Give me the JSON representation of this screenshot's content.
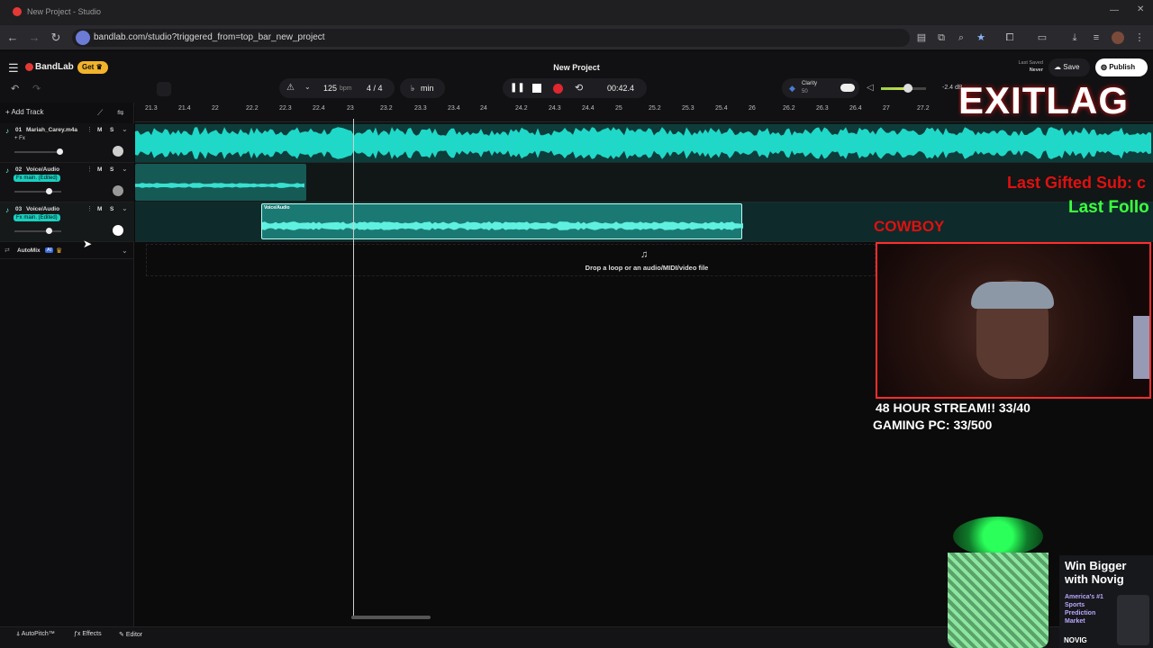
{
  "browser": {
    "tab_title": "New Project - Studio",
    "url": "bandlab.com/studio?triggered_from=top_bar_new_project"
  },
  "app": {
    "brand": "BandLab",
    "get_label": "Get",
    "project_title": "New Project",
    "last_saved_label": "Last Saved",
    "last_saved_value": "Never",
    "save_label": "Save",
    "publish_label": "Publish",
    "tempo": "125",
    "tempo_unit": "bpm",
    "time_sig": "4 / 4",
    "key": "min",
    "time": "00:42.4",
    "clarity_label": "Clarity",
    "clarity_value": "50",
    "volume_db": "-2.4 dB",
    "add_track_label": "Add Track"
  },
  "ruler_ticks": [
    "21.3",
    "21.4",
    "22",
    "22.2",
    "22.3",
    "22.4",
    "23",
    "23.2",
    "23.3",
    "23.4",
    "24",
    "24.2",
    "24.3",
    "24.4",
    "25",
    "25.2",
    "25.3",
    "25.4",
    "26",
    "26.2",
    "26.3",
    "26.4",
    "27",
    "27.2"
  ],
  "tracks": [
    {
      "num": "01",
      "name": "Mariah_Carey.m4a",
      "fx": "+ Fx"
    },
    {
      "num": "02",
      "name": "Voice/Audio",
      "fx": "Fx main. (Edited)"
    },
    {
      "num": "03",
      "name": "Voice/Audio",
      "fx": "Fx main. (Edited)"
    }
  ],
  "track_buttons": {
    "mute": "M",
    "solo": "S"
  },
  "clip_label": "Voice/Audio",
  "automix_label": "AutoMix",
  "ai_badge": "AI",
  "drop_text": "Drop a loop or an audio/MIDI/video file",
  "bottom": {
    "autopitch": "AutoPitch™",
    "effects": "Effects",
    "editor": "Editor"
  },
  "stream_overlay": {
    "logo": "EXITLAG",
    "gifted": "Last Gifted Sub: c",
    "follow": "Last Follo",
    "cowboy": "COWBOY",
    "stream_line1": "48 HOUR STREAM!! 33/40",
    "stream_line2": "GAMING PC: 33/500",
    "ad_title": "Win Bigger with Novig",
    "ad_sub": "America's #1 Sports Prediction Market",
    "ad_brand": "NOVIG"
  }
}
